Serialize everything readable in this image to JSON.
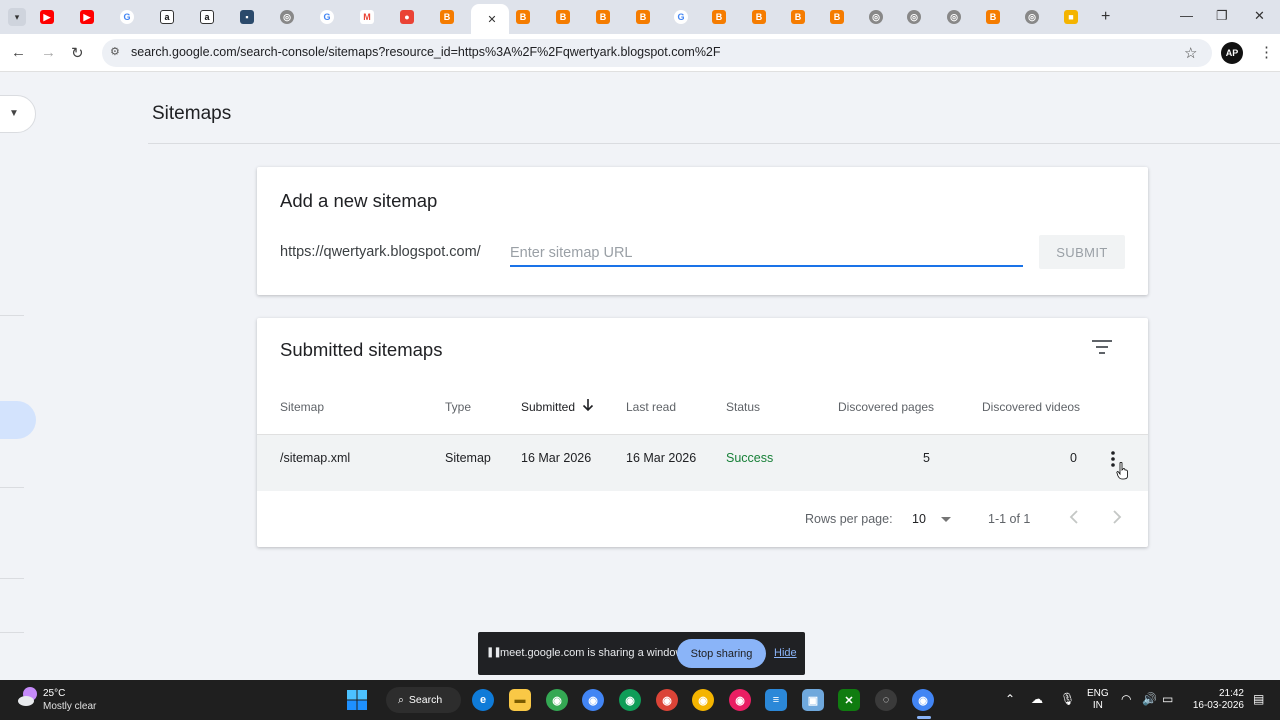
{
  "browser": {
    "url": "search.google.com/search-console/sitemaps?resource_id=https%3A%2F%2Fqwertyark.blogspot.com%2F",
    "profile_initials": "AP"
  },
  "page": {
    "title": "Sitemaps"
  },
  "add_sitemap": {
    "title": "Add a new sitemap",
    "prefix": "https://qwertyark.blogspot.com/",
    "input_value": "",
    "input_placeholder": "Enter sitemap URL",
    "submit_label": "SUBMIT"
  },
  "submitted": {
    "title": "Submitted sitemaps",
    "columns": [
      "Sitemap",
      "Type",
      "Submitted",
      "Last read",
      "Status",
      "Discovered pages",
      "Discovered videos"
    ],
    "sorted_column": "Submitted",
    "rows": [
      {
        "sitemap": "/sitemap.xml",
        "type": "Sitemap",
        "submitted": "16 Mar 2026",
        "last_read": "16 Mar 2026",
        "status": "Success",
        "discovered_pages": "5",
        "discovered_videos": "0"
      }
    ],
    "rows_per_page_label": "Rows per page:",
    "rows_per_page_value": "10",
    "range": "1-1 of 1"
  },
  "share_bar": {
    "message": "meet.google.com is sharing a window.",
    "stop_label": "Stop sharing",
    "hide_label": "Hide"
  },
  "taskbar": {
    "temperature": "25°C",
    "weather": "Mostly clear",
    "search_label": "Search",
    "lang_line1": "ENG",
    "lang_line2": "IN",
    "time": "21:42",
    "date": "16-03-2026"
  },
  "colors": {
    "accent": "#1a73e8",
    "success": "#188038",
    "page_bg": "#f1f3f7"
  }
}
